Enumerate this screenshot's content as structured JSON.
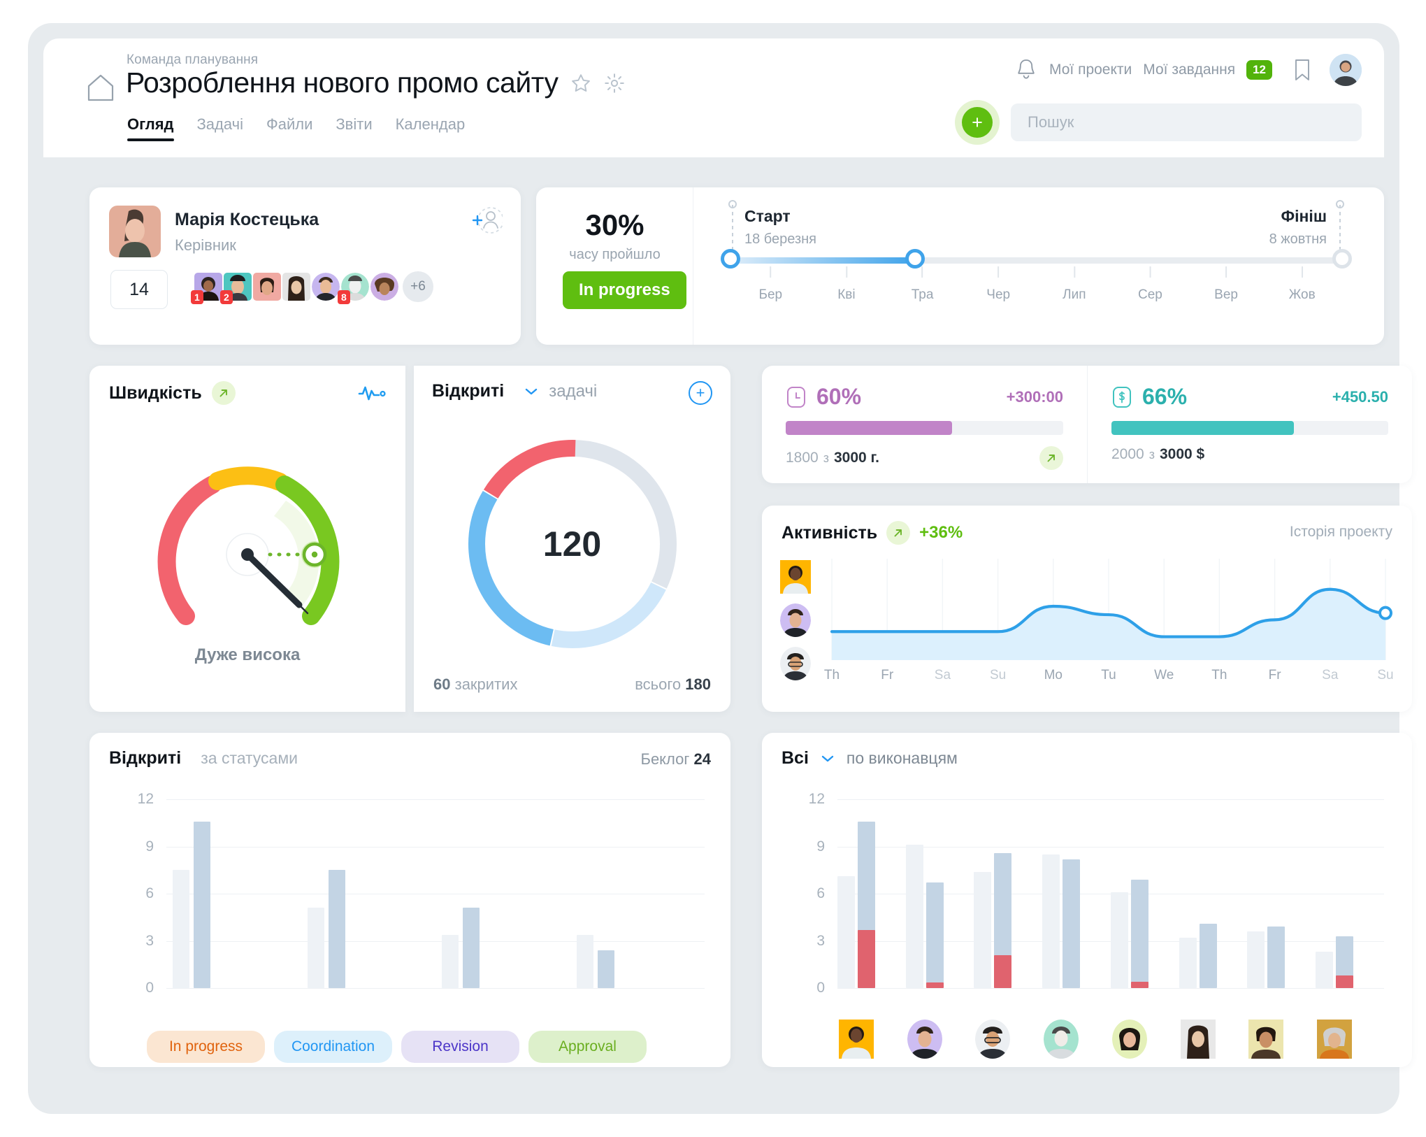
{
  "header": {
    "breadcrumb": "Команда планування",
    "title": "Розроблення нового промо сайту",
    "home_icon": "home-icon",
    "star_icon": "star-icon",
    "gear_icon": "gear-icon",
    "tabs": [
      {
        "label": "Огляд",
        "active": true
      },
      {
        "label": "Задачі",
        "active": false
      },
      {
        "label": "Файли",
        "active": false
      },
      {
        "label": "Звіти",
        "active": false
      },
      {
        "label": "Календар",
        "active": false
      }
    ],
    "bell_icon": "bell-icon",
    "my_projects": "Мої проекти",
    "my_tasks": "Мої завдання",
    "my_tasks_badge": "12",
    "bookmark_icon": "bookmark-icon",
    "avatar": "user-avatar",
    "add_label": "+",
    "search_placeholder": "Пошук",
    "search_value": ""
  },
  "owner": {
    "name": "Марія Костецька",
    "role": "Керівник",
    "add_user_icon": "add-user-icon",
    "count": "14",
    "more": "+6",
    "member_badges": [
      "1",
      "2",
      "",
      "",
      "",
      "8",
      "",
      ""
    ]
  },
  "progress": {
    "percent": "30%",
    "percent_sub": "часу пройшло",
    "status": "In progress",
    "start_label": "Старт",
    "start_date": "18 березня",
    "end_label": "Фініш",
    "end_date": "8 жовтня",
    "months": [
      "Бер",
      "Кві",
      "Тра",
      "Чер",
      "Лип",
      "Сер",
      "Вер",
      "Жов"
    ],
    "fill_pct": 30
  },
  "speed": {
    "title": "Швидкість",
    "trend_icon": "arrow-up-right-icon",
    "pulse_icon": "pulse-icon",
    "value_label": "Дуже висока",
    "colors": {
      "red": "#f2636e",
      "yellow": "#fcbf14",
      "green": "#79c821"
    }
  },
  "open_tasks": {
    "title": "Відкриті",
    "chevron_icon": "chevron-down-icon",
    "subtitle": "задачі",
    "add_icon": "plus-circle-icon",
    "center_value": "120",
    "closed_value": "60",
    "closed_label": "закритих",
    "total_label": "всього",
    "total_value": "180"
  },
  "stats": [
    {
      "icon": "clock-icon",
      "percent": "60%",
      "delta": "+300:00",
      "used": "1800",
      "of_word": "з",
      "total": "3000 г.",
      "fill": 60,
      "color": "#c184c8",
      "arrow_icon": "arrow-up-right-icon"
    },
    {
      "icon": "dollar-icon",
      "percent": "66%",
      "delta": "+450.50",
      "used": "2000",
      "of_word": "з",
      "total": "3000 $",
      "fill": 66,
      "color": "#41c3bf",
      "arrow_icon": ""
    }
  ],
  "activity": {
    "title": "Активність",
    "trend_icon": "arrow-up-right-icon",
    "delta": "+36%",
    "history_link": "Історія проекту",
    "avatars": [
      "member-avatar-1",
      "member-avatar-2",
      "member-avatar-3"
    ]
  },
  "chart_data": [
    {
      "type": "line",
      "name": "activity-sparkline",
      "title": "Активність",
      "x": [
        "Th",
        "Fr",
        "Sa",
        "Su",
        "Mo",
        "Tu",
        "We",
        "Th",
        "Fr",
        "Sa",
        "Su"
      ],
      "values": [
        3.2,
        3.2,
        3.2,
        3.2,
        6.2,
        5.2,
        2.6,
        2.6,
        4.6,
        8.2,
        5.4
      ],
      "ylim": [
        0,
        10
      ],
      "grid": true,
      "legend": "none",
      "color": "#2ea0e8",
      "annotations": [
        "+36%"
      ]
    },
    {
      "type": "bar",
      "name": "open-by-status",
      "title": "Відкриті",
      "subtitle": "за статусами",
      "backlog_label": "Беклог",
      "backlog_value": "24",
      "categories": [
        "In progress",
        "Coordination",
        "Revision",
        "Approval"
      ],
      "series": [
        {
          "name": "planned",
          "values": [
            7.5,
            5.1,
            3.4,
            3.4
          ],
          "color": "#eef2f6"
        },
        {
          "name": "actual",
          "values": [
            10.6,
            7.5,
            5.1,
            2.4
          ],
          "color": "#c3d4e4"
        }
      ],
      "yticks": [
        0,
        3,
        6,
        9,
        12
      ],
      "ylim": [
        0,
        12
      ],
      "grid": true,
      "chip_colors": [
        {
          "bg": "#fbe6d2",
          "fg": "#e0630e"
        },
        {
          "bg": "#ddf0fb",
          "fg": "#2196f3"
        },
        {
          "bg": "#e6e2f5",
          "fg": "#4b35c8"
        },
        {
          "bg": "#ddf0cb",
          "fg": "#6aae20"
        }
      ]
    },
    {
      "type": "bar",
      "name": "all-by-assignee",
      "title": "Всі",
      "subtitle": "по виконавцям",
      "chevron_icon": "chevron-down-icon",
      "categories": [
        "a1",
        "a2",
        "a3",
        "a4",
        "a5",
        "a6",
        "a7",
        "a8"
      ],
      "series": [
        {
          "name": "planned",
          "values": [
            7.1,
            9.1,
            7.4,
            8.5,
            6.1,
            3.2,
            3.6,
            2.3
          ],
          "color": "#eef2f6"
        },
        {
          "name": "actual",
          "values": [
            10.6,
            6.7,
            8.6,
            8.2,
            6.9,
            4.1,
            3.9,
            3.3
          ],
          "color": "#c3d4e4"
        },
        {
          "name": "overdue",
          "values": [
            3.7,
            0.35,
            2.1,
            0,
            0.4,
            0,
            0,
            0.8
          ],
          "color": "#e0636e"
        }
      ],
      "yticks": [
        0,
        3,
        6,
        9,
        12
      ],
      "ylim": [
        0,
        12
      ],
      "grid": true
    },
    {
      "type": "pie",
      "name": "open-tasks-donut",
      "title": "Відкриті",
      "center_value": "120",
      "labels": [
        "open-grey",
        "open-lightblue",
        "open-blue",
        "open-red"
      ],
      "values": [
        32,
        21,
        30,
        17
      ],
      "colors": [
        "#dfe5ec",
        "#cfe7fa",
        "#6cbcf2",
        "#f2636e"
      ]
    },
    {
      "type": "gauge",
      "name": "speed-gauge",
      "title": "Швидкість",
      "value_label": "Дуже висока",
      "value": 98,
      "ylim": [
        0,
        100
      ],
      "zones": [
        {
          "name": "low",
          "color": "#f2636e",
          "from": 0,
          "to": 33
        },
        {
          "name": "mid",
          "color": "#fcbf14",
          "from": 33,
          "to": 66
        },
        {
          "name": "high",
          "color": "#79c821",
          "from": 66,
          "to": 100
        }
      ]
    }
  ],
  "bottom_left": {
    "title": "Відкриті",
    "subtitle": "за статусами",
    "backlog_label": "Беклог",
    "backlog_value": "24"
  },
  "bottom_right": {
    "title": "Всі",
    "chevron_icon": "chevron-down-icon",
    "subtitle": "по виконавцям"
  }
}
